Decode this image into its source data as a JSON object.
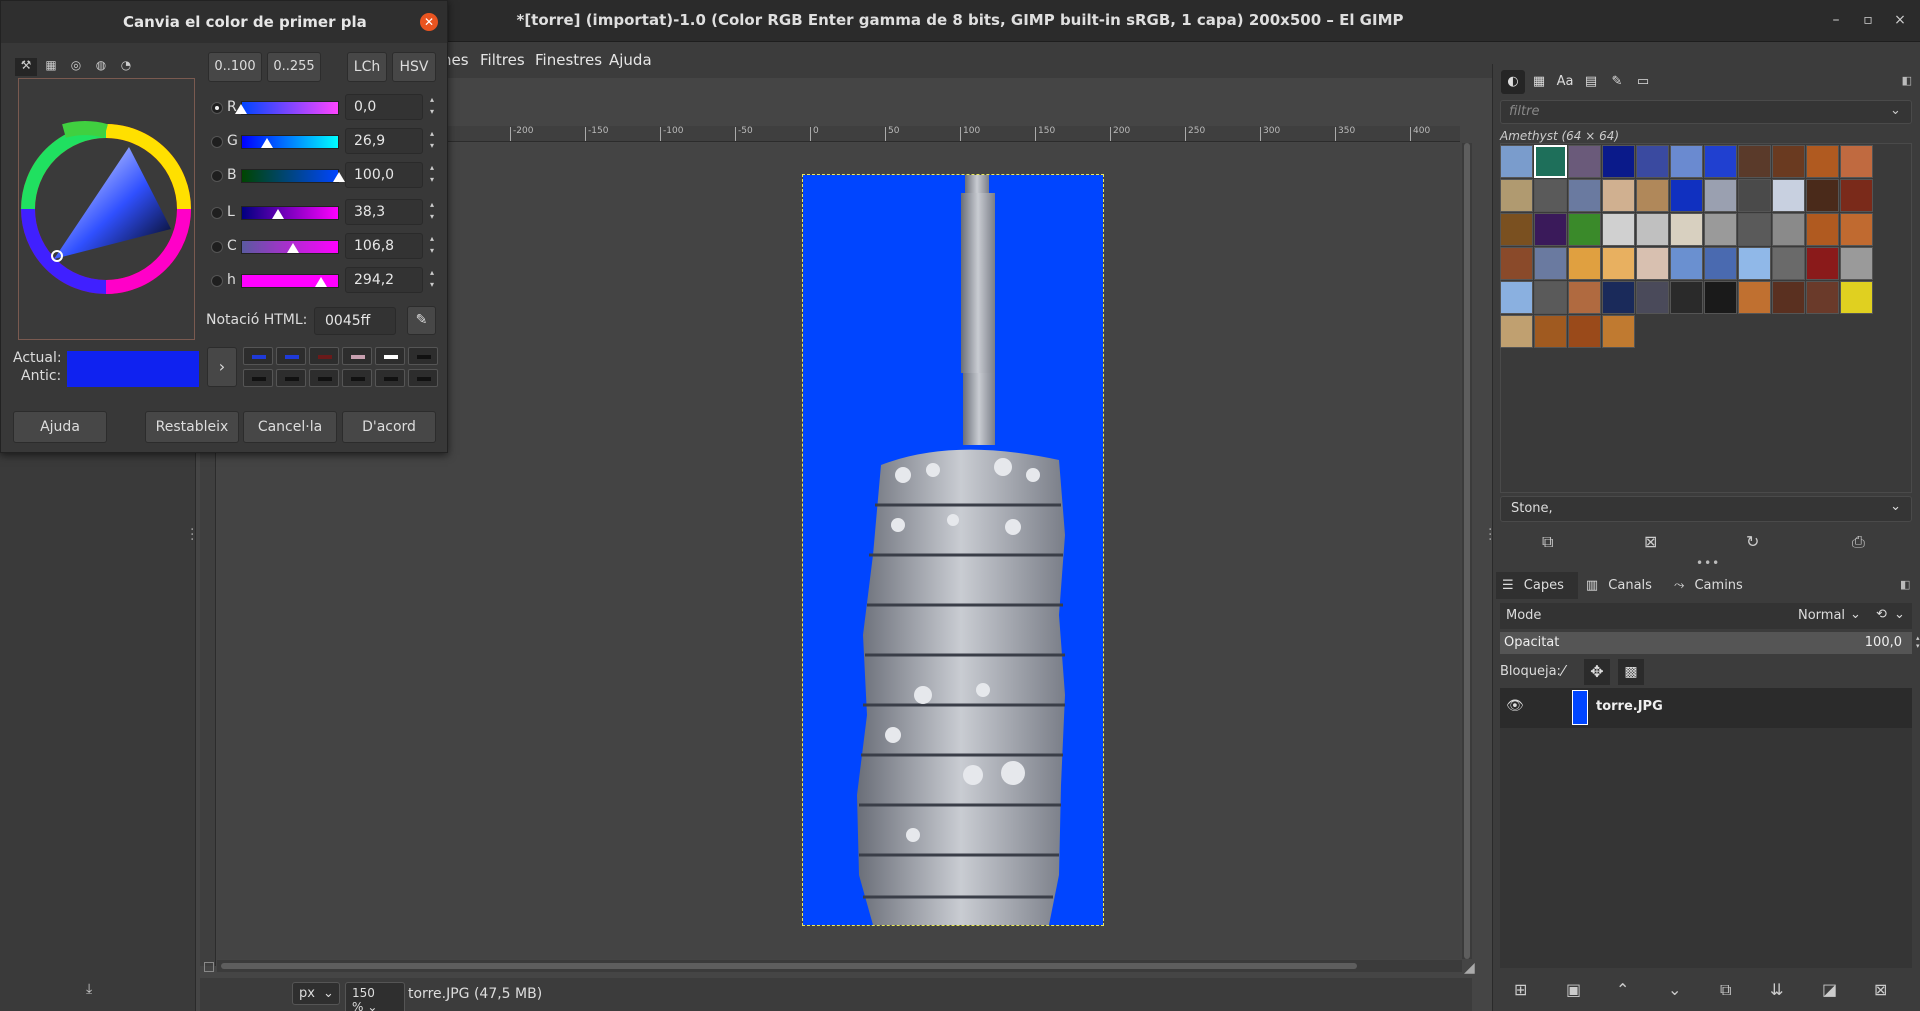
{
  "window": {
    "title": "*[torre] (importat)-1.0 (Color RGB Enter gamma de 8 bits, GIMP built-in sRGB, 1 capa) 200x500 – El GIMP",
    "minimize": "–",
    "maximize": "▫",
    "close": "×"
  },
  "menu": {
    "items": [
      "nes",
      "Filtres",
      "Finestres",
      "Ajuda"
    ]
  },
  "ruler": {
    "labels": [
      "-200",
      "-150",
      "-100",
      "-50",
      "0",
      "50",
      "100",
      "150",
      "200",
      "250",
      "300",
      "350",
      "400"
    ]
  },
  "status": {
    "unit": "px",
    "zoom": "150 %",
    "file": "torre.JPG (47,5 MB)"
  },
  "patterns": {
    "filter_placeholder": "filtre",
    "current": "Amethyst (64 × 64)",
    "tag": "Stone,",
    "swatches": [
      "#7a9ccc",
      "#1e6f5a",
      "#6a5a7a",
      "#0a1a8a",
      "#3a4aa0",
      "#6a8ad0",
      "#2040d0",
      "#5a3a2a",
      "#6a3a20",
      "#b05a20",
      "#c06a40",
      "#b09a70",
      "#5a5a5a",
      "#6a7aa0",
      "#d0b090",
      "#b0885a",
      "#1030c0",
      "#9aa0b0",
      "#4a4a4a",
      "#c8d0e0",
      "#4a2a1a",
      "#7a2a1a",
      "#7a5020",
      "#3a1a5a",
      "#3a8a2a",
      "#d0d0d0",
      "#c0c0c0",
      "#d8d0c0",
      "#9a9a9a",
      "#5a5a5a",
      "#8a8a8a",
      "#b05a20",
      "#c06a30",
      "#8a4a2a",
      "#6a7aa0",
      "#e0a040",
      "#e8b060",
      "#d8c0b0",
      "#6a90d0",
      "#4a6ab0",
      "#90b8e8",
      "#6a6a6a",
      "#8a1a1a",
      "#9a9a9a",
      "#8ab0e0",
      "#5a5a5a",
      "#b06a40",
      "#1a2a5a",
      "#4a4a5a",
      "#2a2a2a",
      "#1a1a1a",
      "#c07030",
      "#5a3020",
      "#6a3a2a",
      "#e0d020",
      "#c0a070",
      "#a05a20",
      "#9a4a1a",
      "#c07a30"
    ],
    "selected_index": 1
  },
  "layers": {
    "tabs": [
      "Capes",
      "Canals",
      "Camins"
    ],
    "mode_label": "Mode",
    "mode_value": "Normal",
    "opacity_label": "Opacitat",
    "opacity_value": "100,0",
    "lock_label": "Bloqueja:",
    "layer_name": "torre.JPG"
  },
  "dialog": {
    "title": "Canvia el color de primer pla",
    "range_buttons": [
      "0..100",
      "0..255"
    ],
    "model_buttons": [
      "LCh",
      "HSV"
    ],
    "channels": [
      {
        "letter": "R",
        "value": "0,0",
        "fraction": 0.0,
        "selected": true
      },
      {
        "letter": "G",
        "value": "26,9",
        "fraction": 0.27,
        "selected": false
      },
      {
        "letter": "B",
        "value": "100,0",
        "fraction": 1.0,
        "selected": false
      },
      {
        "letter": "L",
        "value": "38,3",
        "fraction": 0.38,
        "selected": false
      },
      {
        "letter": "C",
        "value": "106,8",
        "fraction": 0.53,
        "selected": false
      },
      {
        "letter": "h",
        "value": "294,2",
        "fraction": 0.82,
        "selected": false
      }
    ],
    "html_label": "Notació HTML:",
    "html_value": "0045ff",
    "current_label": "Actual:",
    "old_label": "Antic:",
    "current_color": "#0f22f0",
    "history_colors": [
      "#1f3ad8",
      "#1f3ad8",
      "#6a1a1a",
      "#c8a0b0",
      "#ffffff",
      "#111111"
    ],
    "buttons": {
      "help": "Ajuda",
      "reset": "Restableix",
      "cancel": "Cancel·la",
      "ok": "D'acord"
    }
  },
  "colors": {
    "image_bg": "#0045ff",
    "accent_close": "#e95420"
  }
}
